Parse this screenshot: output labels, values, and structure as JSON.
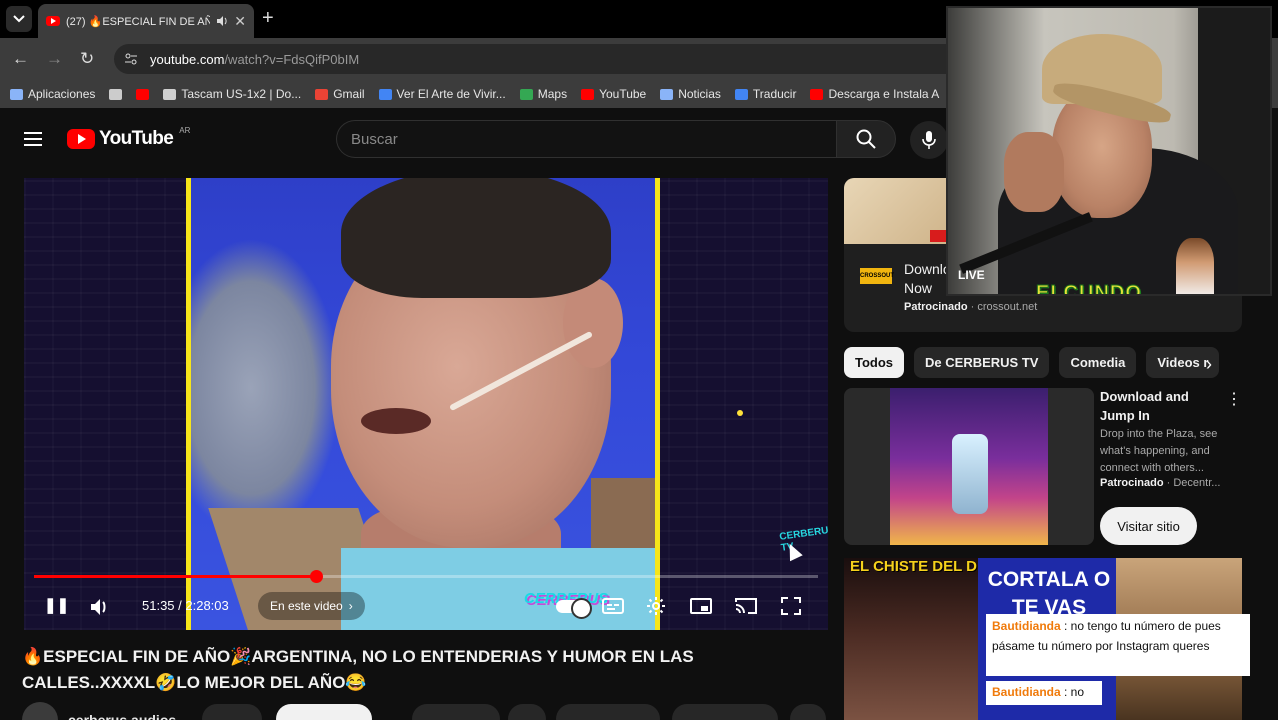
{
  "browser": {
    "tab": {
      "title": "(27) 🔥ESPECIAL FIN DE AÑ",
      "close": "✕"
    },
    "new_tab": "+",
    "url_host": "youtube.com",
    "url_path": "/watch?v=FdsQifP0bIM",
    "bookmarks": [
      {
        "label": "Aplicaciones",
        "color": "#8ab4f8"
      },
      {
        "label": "",
        "color": "#cccccc"
      },
      {
        "label": "",
        "color": "#ff0000"
      },
      {
        "label": "Tascam US-1x2 | Do...",
        "color": "#d0d0d0"
      },
      {
        "label": "Gmail",
        "color": "#ea4335"
      },
      {
        "label": "Ver El Arte de Vivir...",
        "color": "#4285f4"
      },
      {
        "label": "Maps",
        "color": "#34a853"
      },
      {
        "label": "YouTube",
        "color": "#ff0000"
      },
      {
        "label": "Noticias",
        "color": "#8ab4f8"
      },
      {
        "label": "Traducir",
        "color": "#4285f4"
      },
      {
        "label": "Descarga e Instala A",
        "color": "#ff0000"
      }
    ]
  },
  "youtube": {
    "logo": "YouTube",
    "logo_country": "AR",
    "search_placeholder": "Buscar"
  },
  "player": {
    "time": "51:35 / 2:28:03",
    "progress": 0.36,
    "in_video_label": "En este video",
    "watermark": "CERBERUS TV",
    "overlay_logo": "CERBERUS"
  },
  "video": {
    "title": "🔥ESPECIAL FIN DE AÑO🎉ARGENTINA, NO LO ENTENDERIAS Y HUMOR EN LAS CALLES..XXXXL🤣LO MEJOR DEL AÑO😂",
    "channel": "cerberus audios"
  },
  "ad": {
    "title": "Download Now",
    "sponsored": "Patrocinado",
    "domain": "crossout.net",
    "logo": "CROSSOUT"
  },
  "chips": [
    {
      "label": "Todos",
      "active": true
    },
    {
      "label": "De CERBERUS TV",
      "active": false
    },
    {
      "label": "Comedia",
      "active": false
    },
    {
      "label": "Videos r",
      "active": false
    }
  ],
  "recommendation": {
    "title": "Download and Jump In",
    "description": "Drop into the Plaza, see what's happening, and connect with others...",
    "sponsored": "Patrocinado",
    "advertiser": "Decentr...",
    "button": "Visitar sitio"
  },
  "next_thumb": {
    "chiste": "EL CHISTE DEL DIA😂",
    "cortala": "CORTALA O TE VAS"
  },
  "chat": [
    {
      "user": "Bautidianda",
      "text": ": no tengo tu número de pues pásame tu número por Instagram queres"
    },
    {
      "user": "Bautidianda",
      "text": ": no"
    }
  ],
  "webcam": {
    "tag": "ELCUNDO",
    "live": "LIVE"
  }
}
